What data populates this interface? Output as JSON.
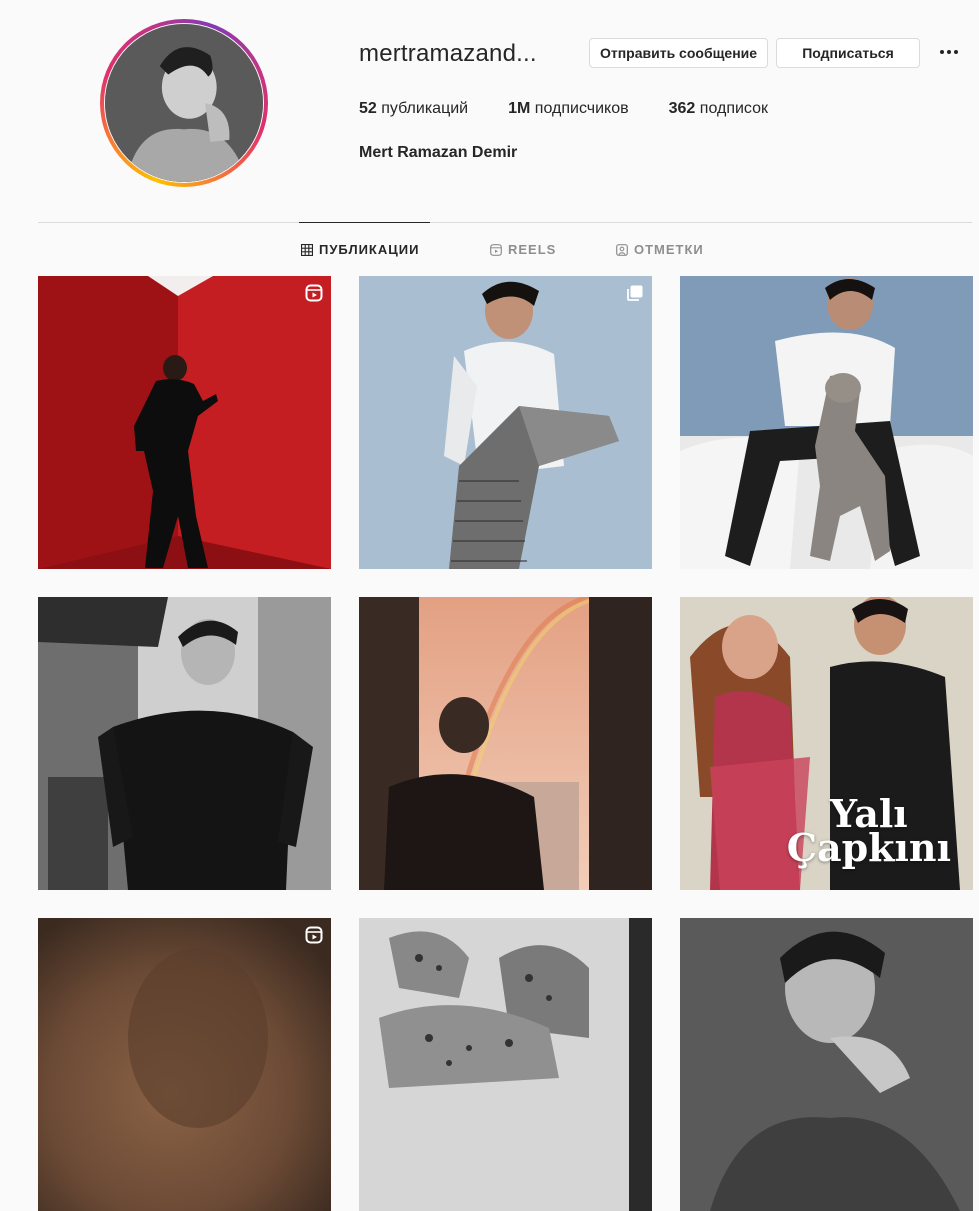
{
  "profile": {
    "username": "mertramazand...",
    "full_name": "Mert Ramazan Demir",
    "message_label": "Отправить сообщение",
    "follow_label": "Подписаться",
    "stats": [
      {
        "value": "52",
        "label": "публикаций"
      },
      {
        "value": "1M",
        "label": "подписчиков"
      },
      {
        "value": "362",
        "label": "подписок"
      }
    ]
  },
  "tabs": [
    {
      "label": "ПУБЛИКАЦИИ",
      "icon": "grid-icon",
      "active": true
    },
    {
      "label": "REELS",
      "icon": "reels-icon",
      "active": false
    },
    {
      "label": "ОТМЕТКИ",
      "icon": "tagged-icon",
      "active": false
    }
  ],
  "posts": [
    {
      "kind": "reel",
      "scene": "man dancing in red room"
    },
    {
      "kind": "carousel",
      "scene": "man in white sweater with coat"
    },
    {
      "kind": "photo",
      "scene": "man with weimaraner dog on bed"
    },
    {
      "kind": "photo",
      "scene": "black and white street portrait"
    },
    {
      "kind": "photo",
      "scene": "window with rainbow"
    },
    {
      "kind": "photo",
      "scene": "poster",
      "overlay_text_line1": "Yalı",
      "overlay_text_line2": "Çapkını"
    },
    {
      "kind": "reel",
      "scene": "blurred warm portrait"
    },
    {
      "kind": "photo",
      "scene": "leopard drawing"
    },
    {
      "kind": "photo",
      "scene": "black and white close portrait"
    }
  ],
  "colors": {
    "accent_text": "#262626",
    "muted_text": "#8e8e8e",
    "border": "#dbdbdb",
    "background": "#fafafa"
  }
}
